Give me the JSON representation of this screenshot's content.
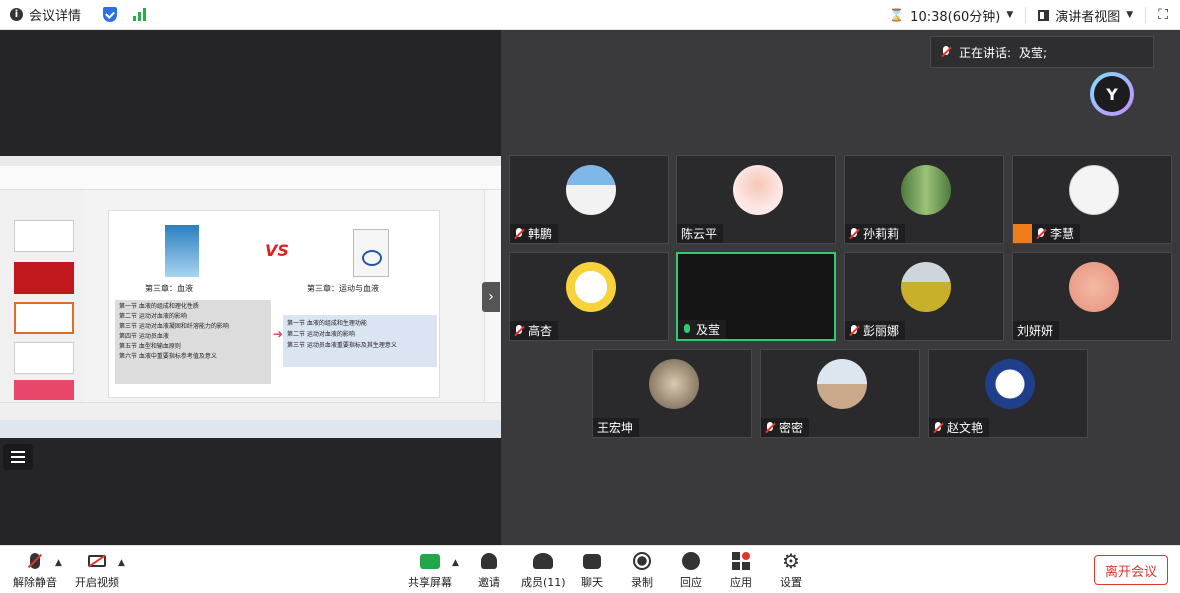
{
  "topbar": {
    "meeting_details": "会议详情",
    "timer": "10:38(60分钟)",
    "view_mode": "演讲者视图"
  },
  "speaking": {
    "label": "正在讲话:",
    "names": "及莹;"
  },
  "participants": [
    {
      "name": "韩鹏",
      "mic": "off"
    },
    {
      "name": "陈云平",
      "mic": "none"
    },
    {
      "name": "孙莉莉",
      "mic": "off"
    },
    {
      "name": "李慧",
      "mic": "off"
    },
    {
      "name": "高杏",
      "mic": "off"
    },
    {
      "name": "及莹",
      "mic": "on"
    },
    {
      "name": "彭丽娜",
      "mic": "off"
    },
    {
      "name": "刘妍妍",
      "mic": "none"
    },
    {
      "name": "王宏坤",
      "mic": "none"
    },
    {
      "name": "密密",
      "mic": "off"
    },
    {
      "name": "赵文艳",
      "mic": "off"
    }
  ],
  "slide": {
    "left_chapter": "第三章：血液",
    "right_chapter": "第三章：运动与血液",
    "left_items": [
      "第一节  血液的组成和理化性质",
      "第二节  运动对血液的影响",
      "第三节  运动对血液凝固和纤溶能力的影响",
      "第四节  运动员血液",
      "第五节  血型和输血原则",
      "第六节  血液中重要指标参考值及意义"
    ],
    "right_items": [
      "第一节  血液的组成和生理功能",
      "第二节  运动对血液的影响",
      "第三节  运动员血液重要指标及其生理意义"
    ],
    "vs": "VS"
  },
  "bottombar": {
    "unmute": "解除静音",
    "start_video": "开启视频",
    "share_screen": "共享屏幕",
    "invite": "邀请",
    "members": "成员(11)",
    "chat": "聊天",
    "record": "录制",
    "react": "回应",
    "apps": "应用",
    "settings": "设置",
    "leave": "离开会议"
  }
}
